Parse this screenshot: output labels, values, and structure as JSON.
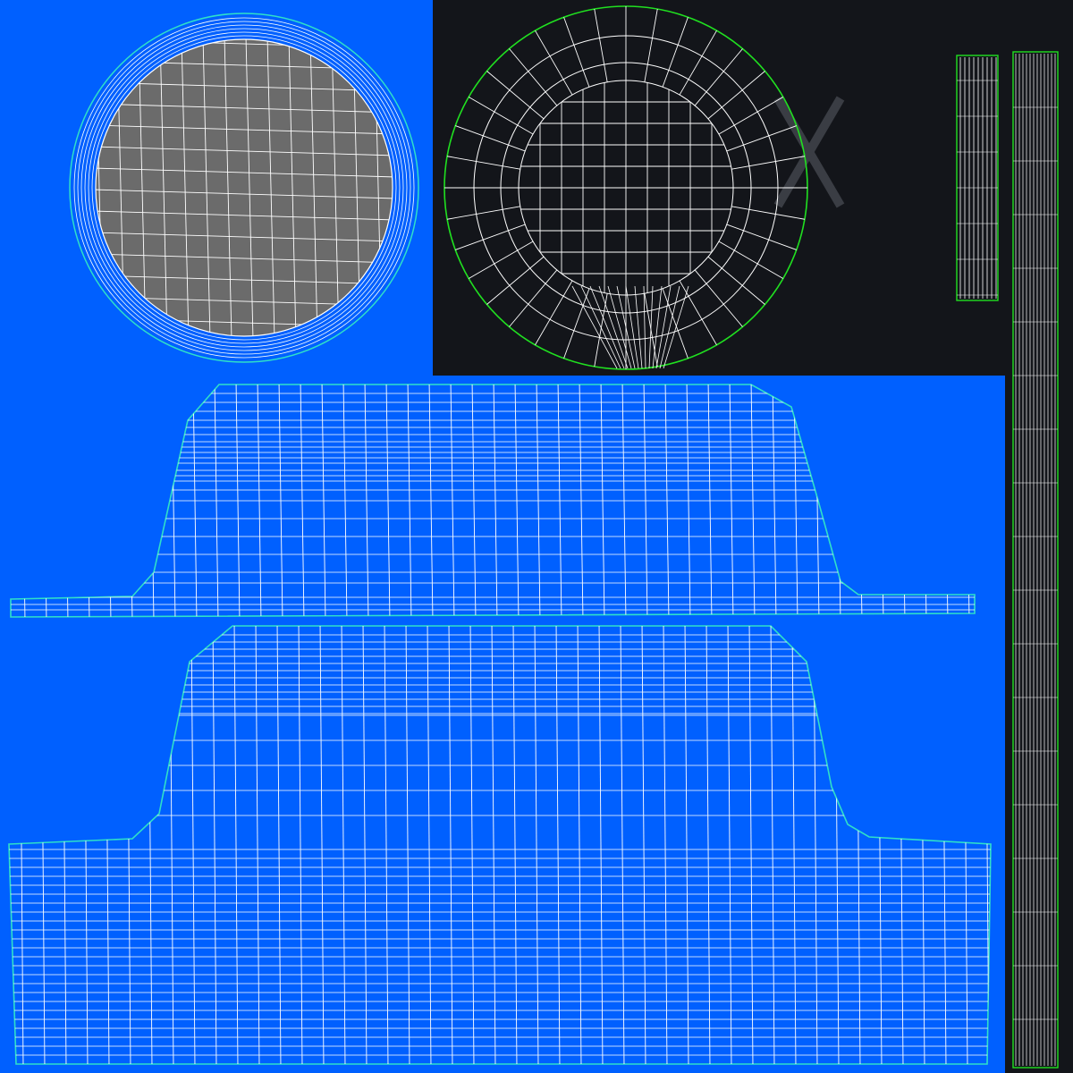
{
  "colors": {
    "background": "#0060ff",
    "dark_panel": "#13151a",
    "wire": "#ffffff",
    "seam": "#20e020",
    "seam_cyan": "#2fe0c8",
    "grey_disc": "#6b6b6b"
  },
  "uv_islands": [
    {
      "name": "cap-top-disc",
      "fill": "grey"
    },
    {
      "name": "cap-bottom-disc",
      "fill": "dark"
    },
    {
      "name": "thin-strip",
      "fill": "dark"
    },
    {
      "name": "long-strip",
      "fill": "dark"
    },
    {
      "name": "upper-side-band",
      "fill": "blue"
    },
    {
      "name": "lower-side-band",
      "fill": "blue"
    }
  ]
}
